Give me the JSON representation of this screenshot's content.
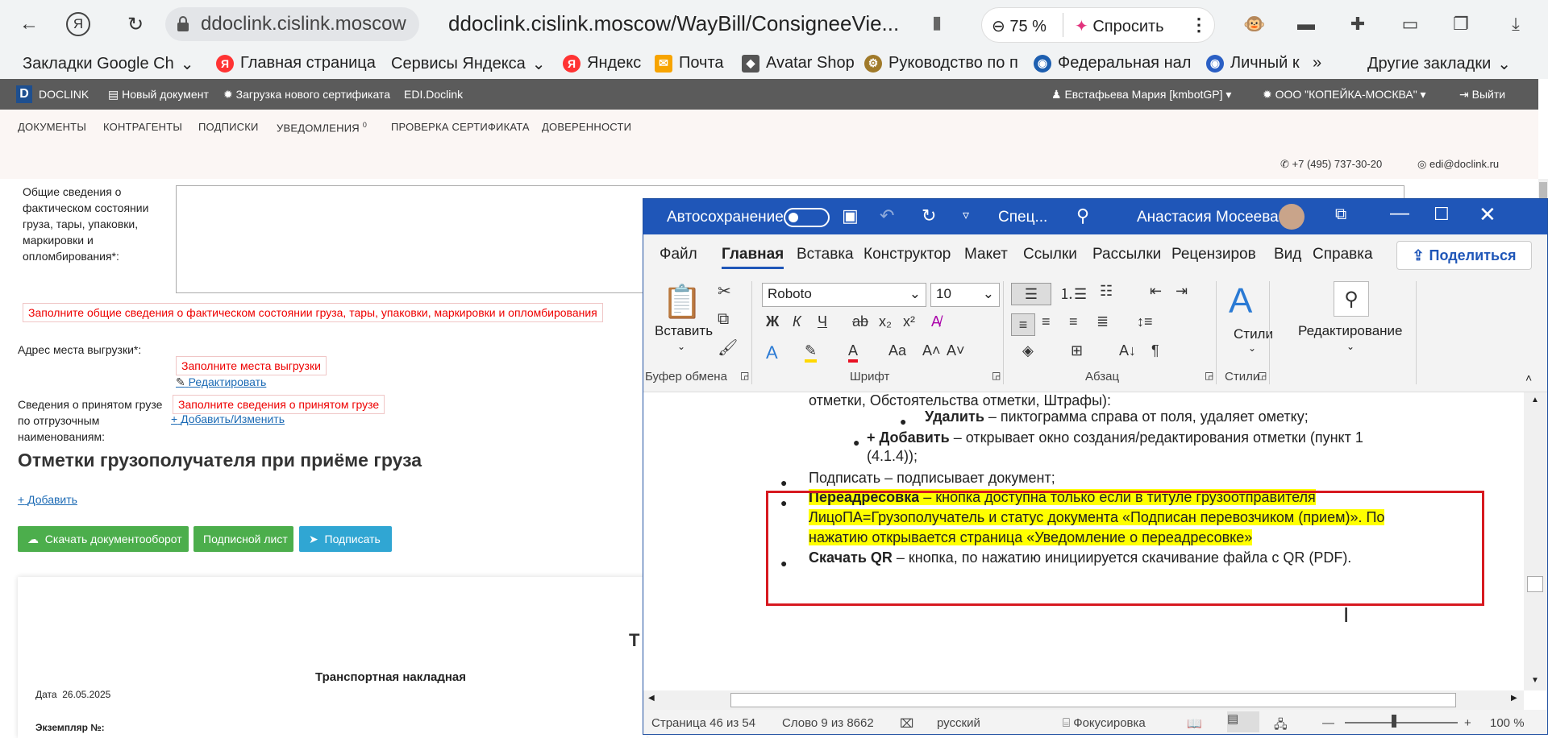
{
  "browser": {
    "nav": {
      "back": "←",
      "yandex": "Я",
      "reload": "↻"
    },
    "url_chip": "ddoclink.cislink.moscow",
    "url": "ddoclink.cislink.moscow/WayBill/ConsigneeVie...",
    "zoom": "75 %",
    "ask": "Спросить",
    "bookmarks": [
      {
        "label": "Закладки Google Ch",
        "icon": "",
        "color": ""
      },
      {
        "label": "Главная страница",
        "icon": "Я",
        "color": "#f33"
      },
      {
        "label": "Сервисы Яндекса",
        "icon": "",
        "color": ""
      },
      {
        "label": "Яндекс",
        "icon": "Я",
        "color": "#f33"
      },
      {
        "label": "Почта",
        "icon": "✉",
        "color": "#f7a400"
      },
      {
        "label": "Avatar Shop",
        "icon": "◆",
        "color": "#555"
      },
      {
        "label": "Руководство по п",
        "icon": "⚙",
        "color": "#a07a2a"
      },
      {
        "label": "Федеральная нал",
        "icon": "◉",
        "color": "#1d5fb0"
      },
      {
        "label": "Личный к",
        "icon": "◉",
        "color": "#2a5fc4"
      }
    ],
    "more": "»",
    "other_bookmarks": "Другие закладки"
  },
  "site": {
    "logo": "D",
    "logo_text": "DOCLINK",
    "new_doc": "Новый документ",
    "upload_cert": "Загрузка нового сертификата",
    "edi": "EDI.Doclink",
    "user": "Евстафьева Мария [kmbotGP]",
    "org": "ООО \"КОПЕЙКА-МОСКВА\"",
    "logout": "Выйти",
    "menu": [
      "ДОКУМЕНТЫ",
      "КОНТРАГЕНТЫ",
      "ПОДПИСКИ",
      "УВЕДОМЛЕНИЯ",
      "ПРОВЕРКА СЕРТИФИКАТА",
      "ДОВЕРЕННОСТИ"
    ],
    "notif_count": "0",
    "phone": "+7 (495) 737-30-20",
    "email": "edi@doclink.ru"
  },
  "form": {
    "general_label": "Общие сведения о фактическом состоянии груза, тары, упаковки, маркировки и опломбирования*:",
    "general_error": "Заполните общие сведения о фактическом состоянии груза, тары, упаковки, маркировки и опломбирования",
    "address_label": "Адрес места выгрузки*:",
    "address_error": "Заполните места выгрузки",
    "edit_link": "Редактировать",
    "cargo_label": "Сведения о принятом грузе по отгрузочным наименованиям:",
    "cargo_error": "Заполните сведения о принятом грузе",
    "add_change_link": "Добавить/Изменить",
    "section_title": "Отметки грузополучателя при приёме груза",
    "add_link": "Добавить",
    "btn_download": "Скачать документооборот",
    "btn_sign_sheet": "Подписной лист",
    "btn_sign": "Подписать",
    "doc_T": "Т",
    "doc_title": "Транспортная накладная",
    "doc_date_label": "Дата",
    "doc_date": "26.05.2025",
    "doc_copy": "Экземпляр №:"
  },
  "word": {
    "autosave": "Автосохранение",
    "doc_name": "Спец...",
    "user": "Анастасия Мосеева",
    "tabs": [
      "Файл",
      "Главная",
      "Вставка",
      "Конструктор",
      "Макет",
      "Ссылки",
      "Рассылки",
      "Рецензиров",
      "Вид",
      "Справка"
    ],
    "active_tab": "Главная",
    "share": "Поделиться",
    "font": "Roboto",
    "size": "10",
    "paste": "Вставить",
    "styles": "Стили",
    "editing": "Редактирование",
    "groups": [
      "Буфер обмена",
      "Шрифт",
      "Абзац",
      "Стили"
    ],
    "doc": {
      "line0": "отметки, Обстоятельства отметки, Штрафы):",
      "del_b": "Удалить",
      "del_t": " – пиктограмма справа от поля, удаляет ометку;",
      "add_b": "+ Добавить",
      "add_t1": " – открывает окно создания/редактирования отметки (пункт 1",
      "add_t2": "(4.1.4));",
      "sign": "Подписать – подписывает документ;",
      "redir_b": "Переадресовка",
      "redir_t1": " – кнопка доступна только если в титуле грузоотправителя",
      "redir_t2": "ЛицоПА=Грузополучатель и статус документа «Подписан перевозчиком (прием)». По",
      "redir_t3": "нажатию открывается страница «Уведомление о переадресовке»",
      "qr_b": "Скачать QR",
      "qr_t": " – кнопка, по нажатию инициируется скачивание файла с QR (PDF)."
    },
    "status": {
      "page": "Страница 46 из 54",
      "words": "Слово 9 из 8662",
      "lang": "русский",
      "focus": "Фокусировка",
      "zoom": "100 %"
    }
  }
}
